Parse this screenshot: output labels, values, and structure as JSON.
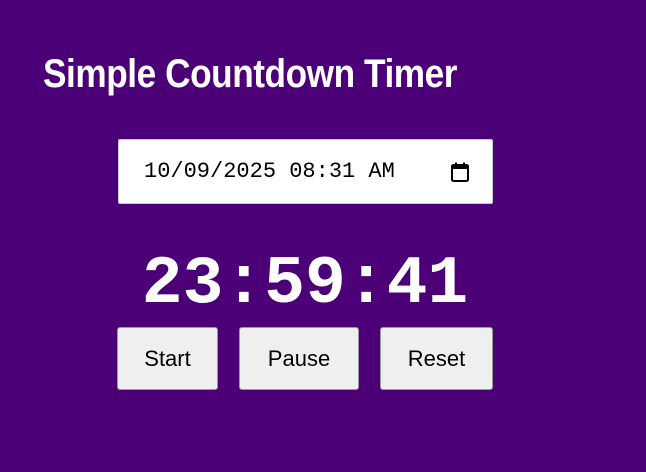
{
  "header": {
    "title": "Simple Countdown Timer"
  },
  "datetime_input": {
    "value": "10/09/2025 08:31 AM",
    "icon": "calendar-icon"
  },
  "countdown": {
    "display": "23:59:41"
  },
  "controls": {
    "start_label": "Start",
    "pause_label": "Pause",
    "reset_label": "Reset"
  },
  "colors": {
    "background": "#4b0078",
    "text": "#ffffff",
    "button_bg": "#efefef"
  }
}
